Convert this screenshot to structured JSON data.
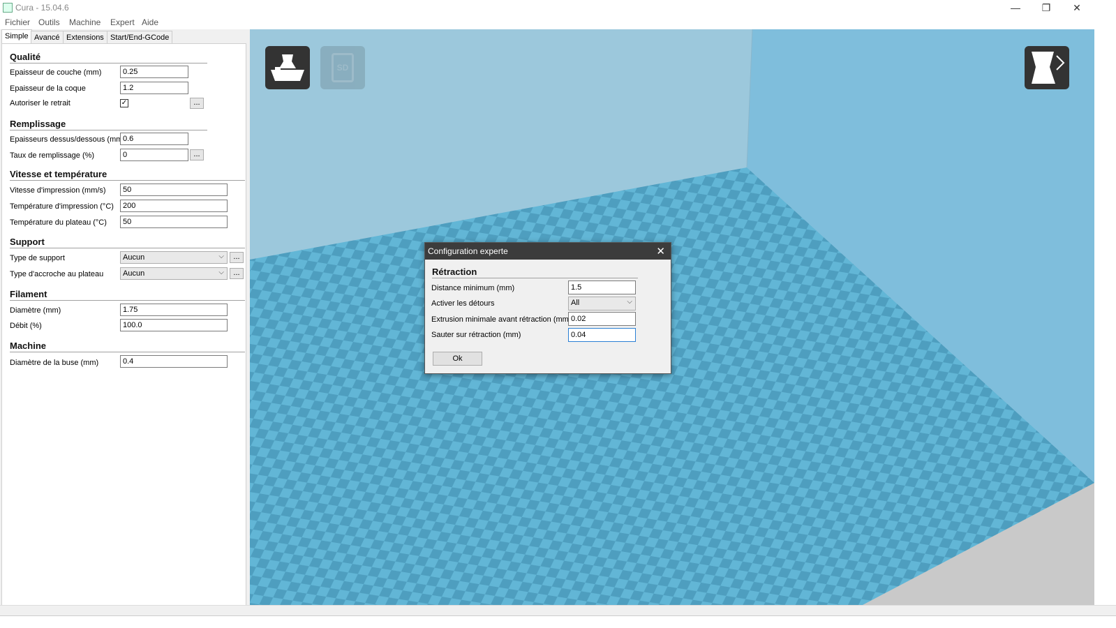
{
  "window": {
    "title": "Cura - 15.04.6",
    "minimize": "—",
    "restore": "❐",
    "close": "✕"
  },
  "menu": [
    "Fichier",
    "Outils",
    "Machine",
    "Expert",
    "Aide"
  ],
  "tabs": [
    "Simple",
    "Avancé",
    "Extensions",
    "Start/End-GCode"
  ],
  "sections": {
    "qualite": {
      "title": "Qualité",
      "layer_height": {
        "label": "Epaisseur de couche (mm)",
        "value": "0.25"
      },
      "shell": {
        "label": "Epaisseur de la coque",
        "value": "1.2"
      },
      "retraction": {
        "label": "Autoriser le retrait",
        "checked": "✓",
        "more": "..."
      }
    },
    "remplissage": {
      "title": "Remplissage",
      "top_bottom": {
        "label": "Epaisseurs dessus/dessous (mm)",
        "value": "0.6"
      },
      "density": {
        "label": "Taux de remplissage (%)",
        "value": "0",
        "more": "..."
      }
    },
    "vitesse": {
      "title": "Vitesse et température",
      "speed": {
        "label": "Vitesse d'impression (mm/s)",
        "value": "50"
      },
      "temp": {
        "label": "Température d'impression (°C)",
        "value": "200"
      },
      "bed": {
        "label": "Température du plateau (°C)",
        "value": "50"
      }
    },
    "support": {
      "title": "Support",
      "type": {
        "label": "Type de support",
        "value": "Aucun",
        "more": "..."
      },
      "adhesion": {
        "label": "Type d'accroche au plateau",
        "value": "Aucun",
        "more": "..."
      }
    },
    "filament": {
      "title": "Filament",
      "diameter": {
        "label": "Diamètre (mm)",
        "value": "1.75"
      },
      "flow": {
        "label": "Débit (%)",
        "value": "100.0"
      }
    },
    "machine": {
      "title": "Machine",
      "nozzle": {
        "label": "Diamètre de la buse (mm)",
        "value": "0.4"
      }
    }
  },
  "viewport": {
    "load_button_icon": "load-model-icon",
    "sd_button_label": "SD",
    "view_mode_icon": "view-mode-icon",
    "colors": {
      "floor": "#62b6d6",
      "checker": "#4e9ebf",
      "wall": "#9cc8dc"
    }
  },
  "dialog": {
    "title": "Configuration experte",
    "close": "✕",
    "section": "Rétraction",
    "min_distance": {
      "label": "Distance minimum (mm)",
      "value": "1.5"
    },
    "combing": {
      "label": "Activer les détours",
      "value": "All"
    },
    "min_extrusion": {
      "label": "Extrusion minimale avant rétraction (mm)",
      "value": "0.02"
    },
    "z_hop": {
      "label": "Sauter sur rétraction (mm)",
      "value": "0.04"
    },
    "ok": "Ok"
  }
}
